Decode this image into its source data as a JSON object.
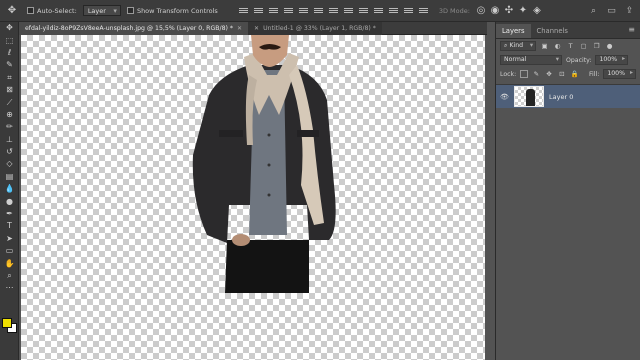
{
  "options_bar": {
    "tool_icon": "move-tool-icon",
    "auto_select_label": "Auto-Select:",
    "auto_select_target": "Layer",
    "show_transform_label": "Show Transform Controls",
    "mode_3d_label": "3D Mode:"
  },
  "tabs": [
    {
      "label": "efdal-yildiz-8oP9ZsV8eeA-unsplash.jpg @ 15,5% (Layer 0, RGB/8) *",
      "active": true
    },
    {
      "label": "Untitled-1 @ 33% (Layer 1, RGB/8) *",
      "active": false
    }
  ],
  "toolbar": {
    "tools": [
      "move-tool",
      "artboard-tool",
      "marquee-tool",
      "lasso-tool",
      "quick-select-tool",
      "crop-tool",
      "eyedropper-tool",
      "healing-tool",
      "brush-tool",
      "clone-stamp-tool",
      "history-brush-tool",
      "eraser-tool",
      "gradient-tool",
      "blur-tool",
      "dodge-tool",
      "pen-tool",
      "type-tool",
      "path-select-tool",
      "shape-tool",
      "hand-tool",
      "zoom-tool",
      "edit-toolbar"
    ],
    "foreground_color": "#f0e000",
    "background_color": "#ffffff"
  },
  "panels": {
    "tabs": [
      "Layers",
      "Channels"
    ],
    "filter_kind": "Kind",
    "blend_mode": "Normal",
    "opacity_label": "Opacity:",
    "opacity_value": "100%",
    "lock_label": "Lock:",
    "fill_label": "Fill:",
    "fill_value": "100%",
    "layers": [
      {
        "name": "Layer 0",
        "visible": true,
        "selected": true
      }
    ]
  }
}
